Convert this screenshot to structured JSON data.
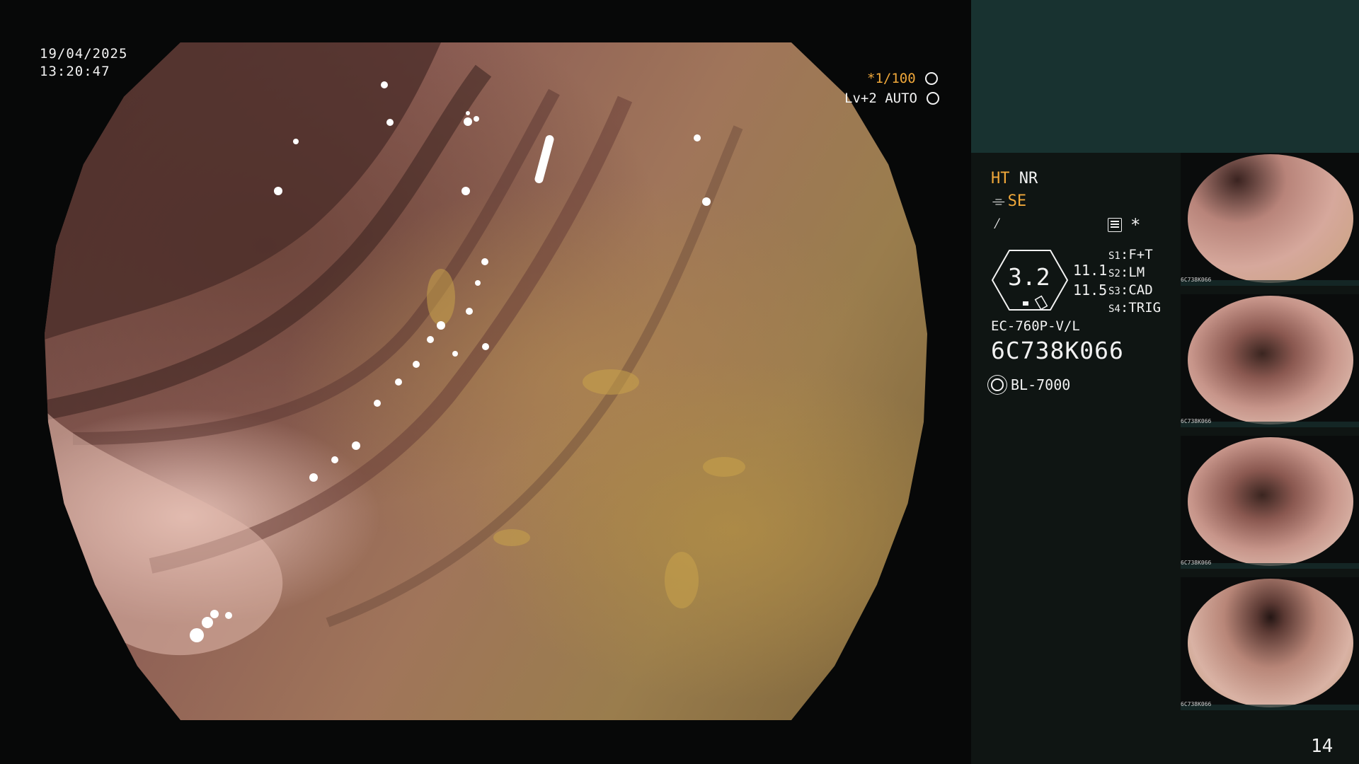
{
  "header": {
    "date": "19/04/2025",
    "time": "13:20:47"
  },
  "scope_overlay": {
    "zoom": "*1/100",
    "level": "Lv+2 AUTO"
  },
  "settings": {
    "ht": "HT",
    "nr": "NR",
    "se": "SE",
    "f_icon": "⁄",
    "star": "*",
    "hex_value": "3.2",
    "value_1": "11.1",
    "value_2": "11.5",
    "s1": "F+T",
    "s2": "LM",
    "s3": "CAD",
    "s4": "TRIG",
    "model": "EC-760P-V/L",
    "serial": "6C738K066",
    "light_source": "BL-7000"
  },
  "thumbnails": [
    {
      "caption": "6C738K066"
    },
    {
      "caption": "6C738K066"
    },
    {
      "caption": "6C738K066"
    },
    {
      "caption": "6C738K066"
    }
  ],
  "page_number": "14"
}
